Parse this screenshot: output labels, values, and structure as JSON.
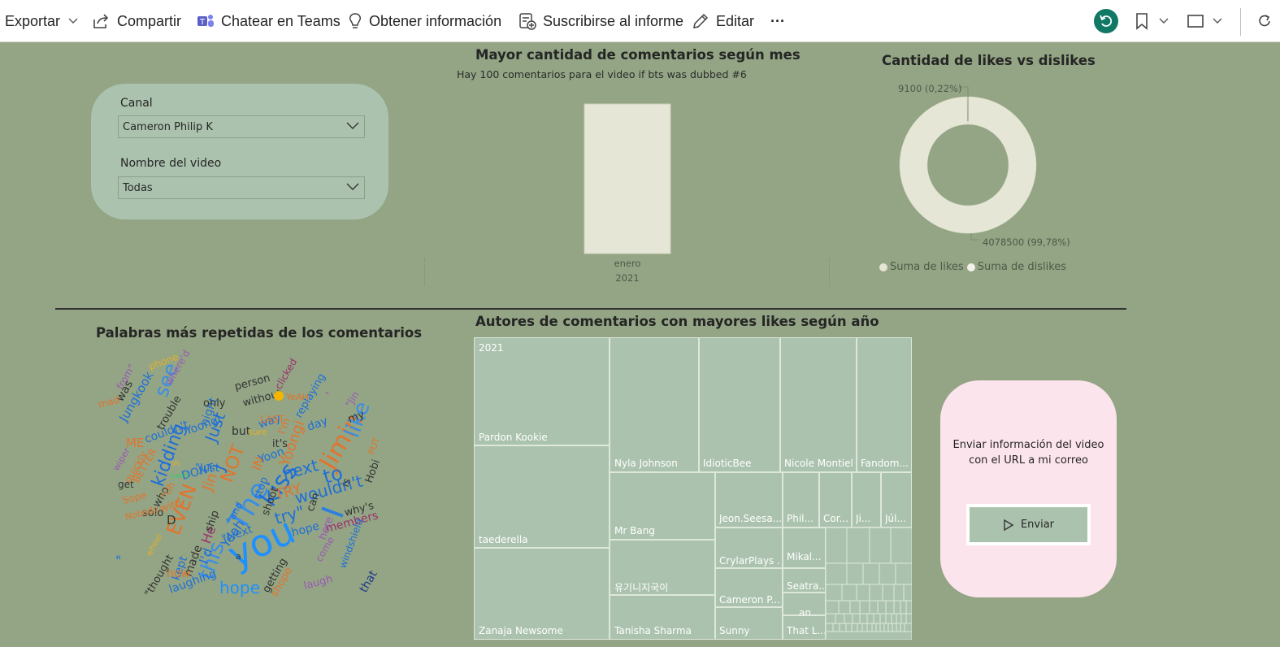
{
  "toolbar": {
    "export": "Exportar",
    "share": "Compartir",
    "teams": "Chatear en Teams",
    "insights": "Obtener información",
    "subscribe": "Suscribirse al informe",
    "edit": "Editar",
    "more": "···"
  },
  "slicer": {
    "channel_label": "Canal",
    "channel_value": "Cameron Philip K",
    "video_label": "Nombre del video",
    "video_value": "Todas"
  },
  "bar_visual": {
    "title": "Mayor cantidad de comentarios según mes",
    "subtitle": "Hay 100 comentarios para el video if bts was dubbed #6"
  },
  "donut_visual": {
    "title": "Cantidad de likes vs dislikes",
    "label_dislikes": "9100 (0,22%)",
    "label_likes": "4078500 (99,78%)",
    "legend_likes": "Suma de likes",
    "legend_dislikes": "Suma de dislikes"
  },
  "wordcloud": {
    "title": "Palabras más repetidas de los comentarios"
  },
  "treemap": {
    "title": "Autores de comentarios con mayores likes según año",
    "year": "2021",
    "authors": [
      "Pardon Kookie",
      "taederella",
      "Zanaja Newsome",
      "Nyla Johnson",
      "IdioticBee",
      "Nicole Montiel",
      "Fandom...",
      "Mr Bang",
      "유기니지국이",
      "Tanisha Sharma",
      "Jeon.Seesa...",
      "Phil...",
      "Cor...",
      "Ji...",
      "Júl...",
      "CrylarPlays ...",
      "Mikal...",
      "Cameron P...",
      "Seatra...",
      "Sunny",
      "an...",
      "That L..."
    ]
  },
  "send_card": {
    "text": "Enviar información del video con el URL a mi correo",
    "button": "Enviar"
  },
  "colors": {
    "background": "#93a584",
    "card": "#abc3ae",
    "bar": "#e6e6d6",
    "pink_card": "#fce4ec"
  },
  "chart_data": [
    {
      "type": "bar",
      "title": "Mayor cantidad de comentarios según mes",
      "categories": [
        "enero"
      ],
      "category_group": "2021",
      "values": [
        100
      ],
      "ylim": [
        0,
        100
      ]
    },
    {
      "type": "pie",
      "title": "Cantidad de likes vs dislikes",
      "series": [
        {
          "name": "Suma de likes",
          "value": 4078500,
          "percent": 99.78
        },
        {
          "name": "Suma de dislikes",
          "value": 9100,
          "percent": 0.22
        }
      ],
      "donut": true
    }
  ]
}
